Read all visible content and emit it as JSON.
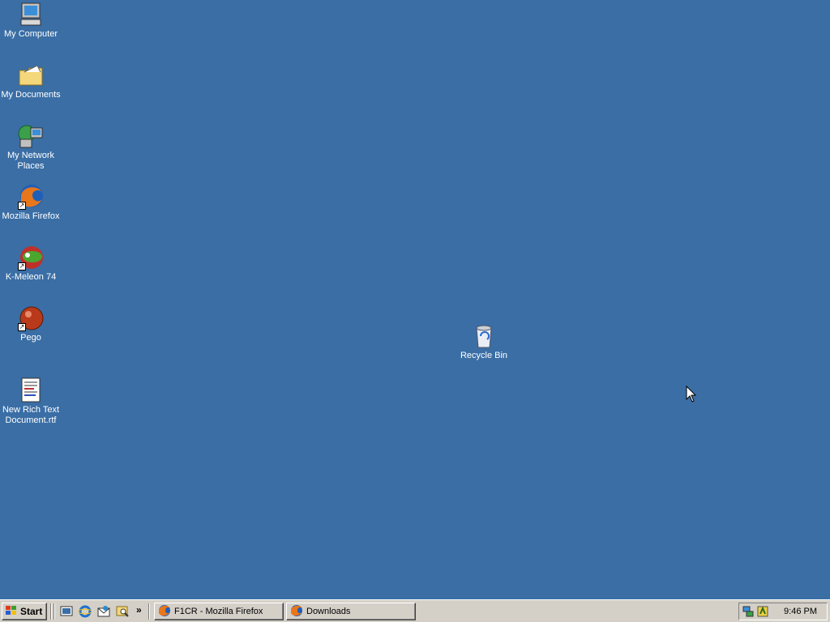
{
  "desktop": {
    "icons": [
      {
        "label": "My Computer",
        "icon": "computer-icon"
      },
      {
        "label": "My Documents",
        "icon": "folder-icon"
      },
      {
        "label": "My Network Places",
        "icon": "network-icon"
      },
      {
        "label": "Mozilla Firefox",
        "icon": "firefox-icon"
      },
      {
        "label": "K-Meleon 74",
        "icon": "kmeleon-icon"
      },
      {
        "label": "Pego",
        "icon": "pego-icon"
      },
      {
        "label": "New Rich Text Document.rtf",
        "icon": "rtf-document-icon"
      },
      {
        "label": "Recycle Bin",
        "icon": "recycle-bin-icon"
      }
    ]
  },
  "taskbar": {
    "start_label": "Start",
    "tasks": [
      {
        "label": "F1CR - Mozilla Firefox",
        "icon": "firefox-icon"
      },
      {
        "label": "Downloads",
        "icon": "firefox-icon"
      }
    ],
    "quick_launch": [
      "desktop-icon",
      "internet-explorer-icon",
      "outlook-express-icon",
      "search-icon"
    ],
    "chevron": "»",
    "clock": "9:46 PM"
  },
  "colors": {
    "desktop": "#3a6ea5",
    "taskbar": "#d4d0c8"
  }
}
